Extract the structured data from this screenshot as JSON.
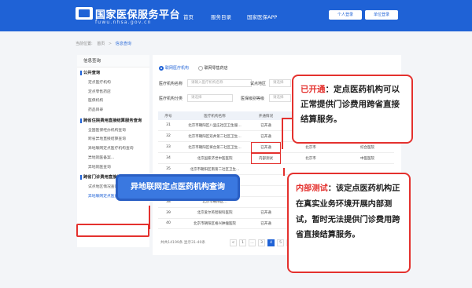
{
  "header": {
    "site_title": "国家医保服务平台",
    "site_url": "fuwu.nhsa.gov.cn",
    "nav": [
      "首页",
      "服务目录",
      "国家医保APP"
    ],
    "buttons": [
      "个人登录",
      "单位登录"
    ]
  },
  "breadcrumb": [
    "当前位置:",
    "首页",
    "信息查询"
  ],
  "sidebar": {
    "head": "信息查询",
    "group1": "公共查询",
    "group1_items": [
      "定点医疗机构",
      "定点零售药店",
      "医保机构",
      "药品目录"
    ],
    "group2": "跨省住院费用直接结算服务查询",
    "group2_items": [
      "全国医保经办机构查询",
      "跨省异地直接结算查询",
      "异地联网定点医疗机构查询",
      "异地就医备案…",
      "异地就医查询"
    ],
    "group3": "跨省门诊费用直接结算",
    "group3_items": [
      "试点地区情况查询",
      "异地联网定点医药机构查询"
    ]
  },
  "filters": {
    "radio1": "联网医疗机构",
    "radio2": "联网零售药店",
    "name_label": "医疗机构名称",
    "name_placeholder": "请输入医疗机构名称",
    "area_label": "试点地区",
    "area_placeholder": "请选择",
    "type_label": "医疗机构分类",
    "type_placeholder": "请选择",
    "level_label": "医保级别等级",
    "level_placeholder": "请选择"
  },
  "table": {
    "headers": [
      "序号",
      "医疗机构名称",
      "开通情况",
      "",
      ""
    ],
    "rows": [
      {
        "no": "31",
        "name": "北京市朝阳区八里庄社区卫生服…",
        "status": "已开通",
        "area": "",
        "level": ""
      },
      {
        "no": "32",
        "name": "北京市朝阳区双井第二社区卫生…",
        "status": "已开通",
        "area": "",
        "level": ""
      },
      {
        "no": "33",
        "name": "北京市朝阳区将台第二社区卫生…",
        "status": "已开通",
        "area": "北京市",
        "level": "综合医院"
      },
      {
        "no": "34",
        "name": "北京国家济世中医医院",
        "status": "内部测试",
        "area": "北京市",
        "level": "中医医院"
      },
      {
        "no": "35",
        "name": "北京市朝阳区南第二社区卫生…",
        "status": "",
        "area": "",
        "level": ""
      },
      {
        "no": "36",
        "name": "北京市朝阳区…",
        "status": "",
        "area": "",
        "level": ""
      },
      {
        "no": "37",
        "name": "北京市…",
        "status": "",
        "area": "",
        "level": ""
      },
      {
        "no": "38",
        "name": "北京市朝阳区…",
        "status": "",
        "area": "",
        "level": ""
      },
      {
        "no": "39",
        "name": "北京爱尔英智眼科医院",
        "status": "已开通",
        "area": "",
        "level": ""
      },
      {
        "no": "40",
        "name": "北京市朝阳区格兴肿瘤医院",
        "status": "已开通",
        "area": "",
        "level": ""
      }
    ]
  },
  "pager": {
    "summary": "共共14199条  显示31-40条",
    "pages": [
      "<",
      "1",
      "…",
      "3",
      "4",
      "5",
      "…",
      ">"
    ]
  },
  "callout1": {
    "term": "已开通",
    "text": "：定点医药机构可以正常提供门诊费用跨省直接结算服务。"
  },
  "callout2": {
    "term": "内部测试",
    "text": "：该定点医药机构正在真实业务环境开展内部测试，暂时无法提供门诊费用跨省直接结算服务。"
  },
  "blue_label": "异地联网定点医药机构查询",
  "colors": {
    "brand": "#1f62d6",
    "highlight": "#e4312e"
  }
}
